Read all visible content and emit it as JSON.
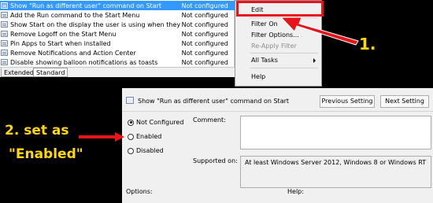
{
  "policy_list": {
    "rows": [
      {
        "name": "Show \"Run as different user\" command on Start",
        "state": "Not configured",
        "selected": true
      },
      {
        "name": "Add the Run command to the Start Menu",
        "state": "Not configured",
        "selected": false
      },
      {
        "name": "Show Start on the display the user is using when they press t...",
        "state": "Not configured",
        "selected": false
      },
      {
        "name": "Remove Logoff on the Start Menu",
        "state": "Not configured",
        "selected": false
      },
      {
        "name": "Pin Apps to Start when installed",
        "state": "Not configured",
        "selected": false
      },
      {
        "name": "Remove Notifications and Action Center",
        "state": "Not configured",
        "selected": false
      },
      {
        "name": "Disable showing balloon notifications as toasts",
        "state": "Not configured",
        "selected": false
      }
    ],
    "tabs": {
      "extended": "Extended",
      "standard": "Standard"
    }
  },
  "context_menu": {
    "items": [
      "Edit",
      "Filter On",
      "Filter Options...",
      "Re-Apply Filter",
      "All Tasks",
      "Help"
    ]
  },
  "editor": {
    "title": "Show \"Run as different user\" command on Start",
    "previous_button": "Previous Setting",
    "next_button": "Next Setting",
    "radio_options": [
      "Not Configured",
      "Enabled",
      "Disabled"
    ],
    "selected_option": "Not Configured",
    "comment_label": "Comment:",
    "supported_label": "Supported on:",
    "supported_value": "At least Windows Server 2012, Windows 8 or Windows RT",
    "options_label": "Options:",
    "help_label": "Help:"
  },
  "annotations": {
    "step1": "1.",
    "step2_line1": "2. set as",
    "step2_line2": "\"Enabled\"",
    "color": "#ffd800",
    "highlight_color": "#e8141a"
  }
}
